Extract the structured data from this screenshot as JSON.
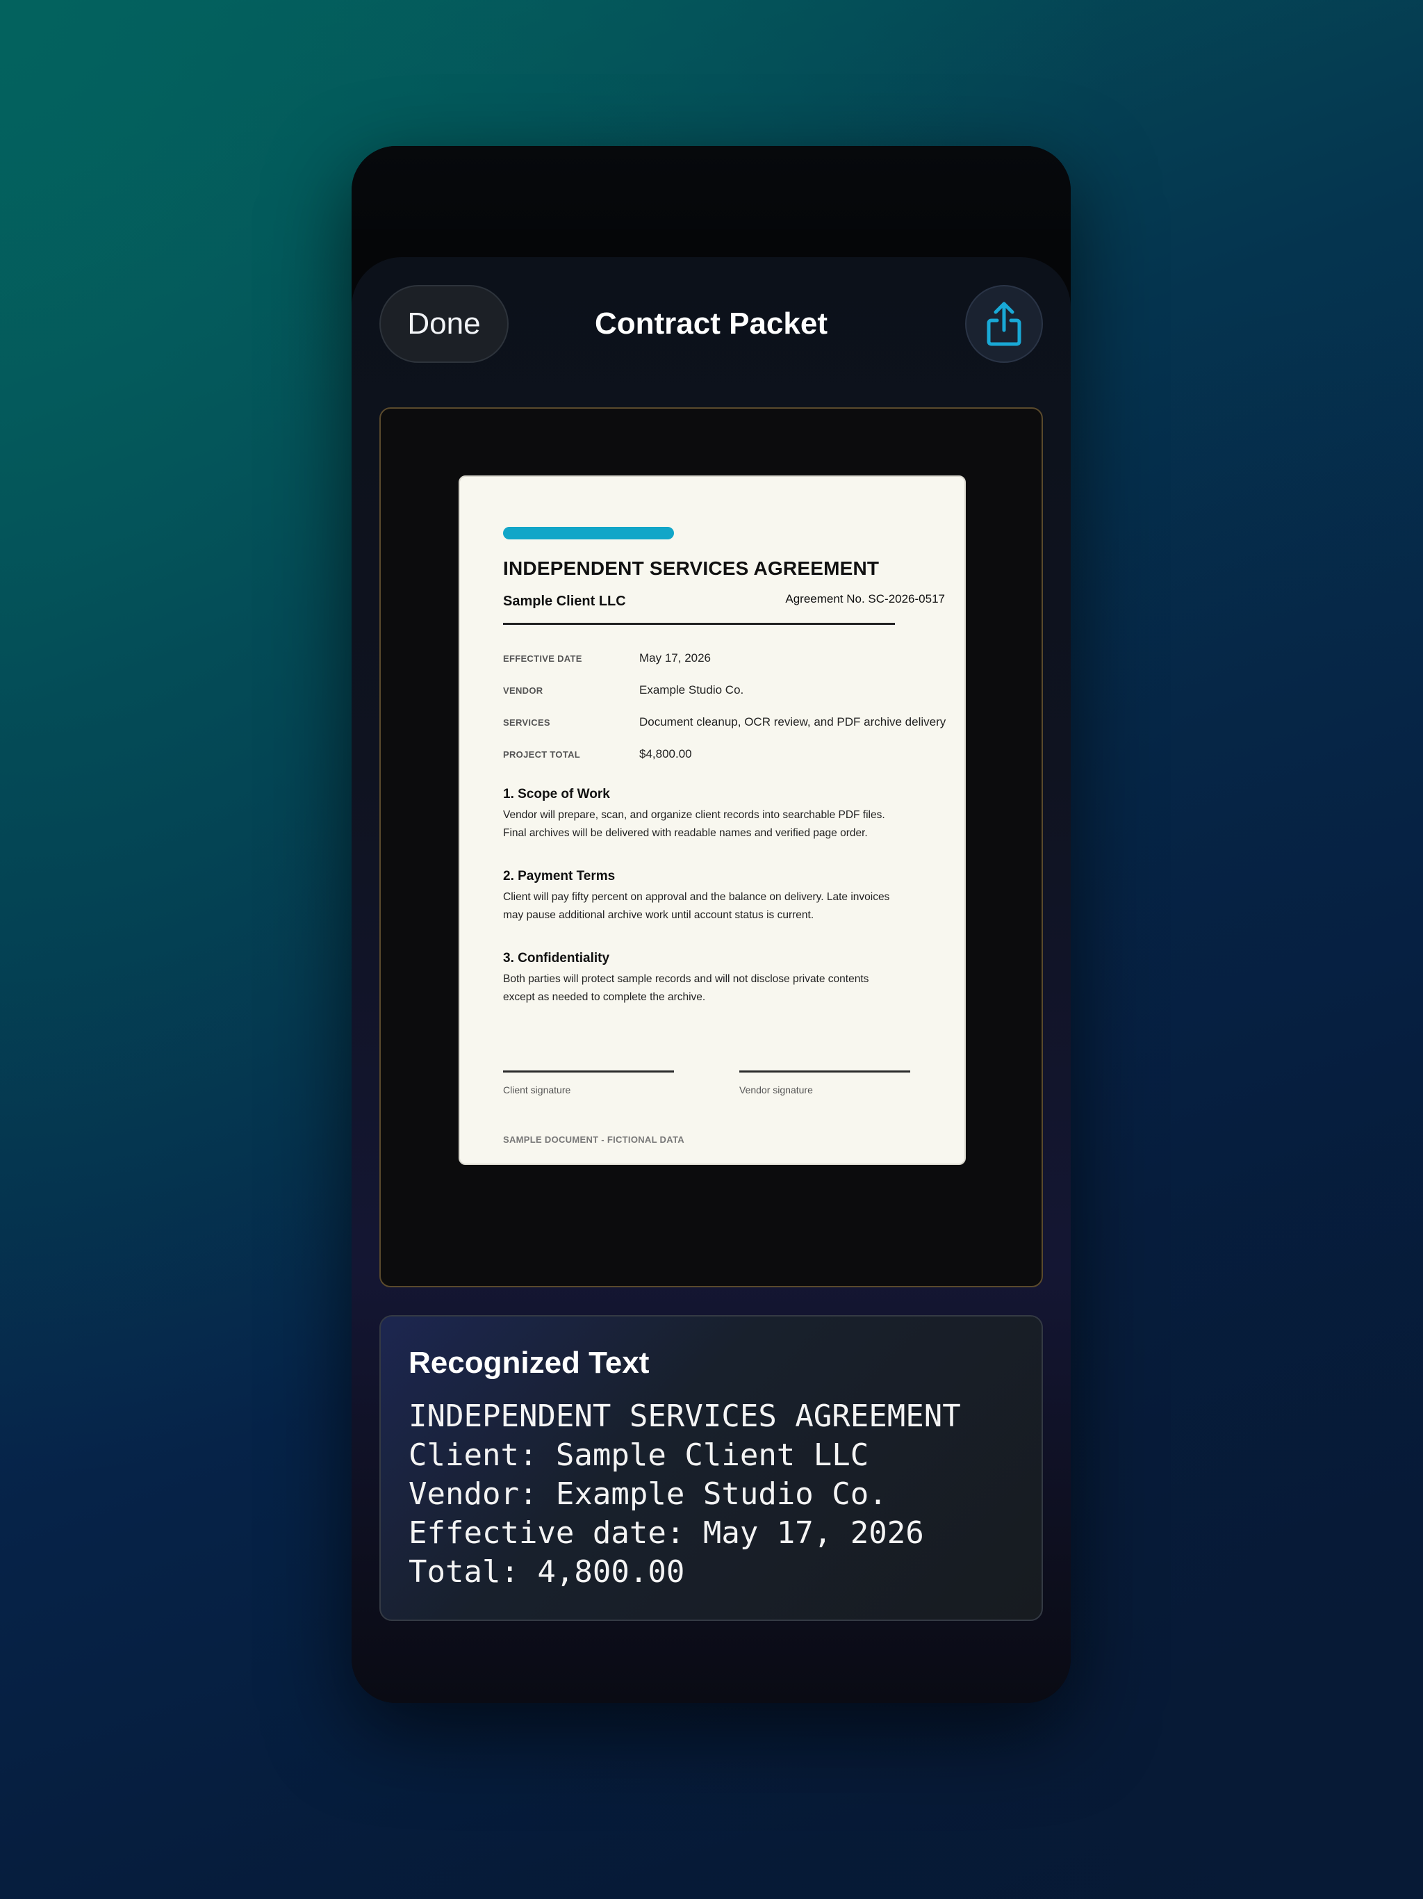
{
  "header": {
    "done_label": "Done",
    "title": "Contract Packet",
    "share_icon": "share-icon"
  },
  "document": {
    "accent_color": "#12a6c8",
    "title": "INDEPENDENT SERVICES AGREEMENT",
    "client": "Sample Client LLC",
    "agreement_no": "Agreement No. SC-2026-0517",
    "fields": [
      {
        "label": "EFFECTIVE DATE",
        "value": "May 17, 2026"
      },
      {
        "label": "VENDOR",
        "value": "Example Studio Co."
      },
      {
        "label": "SERVICES",
        "value": "Document cleanup, OCR review, and PDF archive delivery"
      },
      {
        "label": "PROJECT TOTAL",
        "value": "$4,800.00"
      }
    ],
    "sections": [
      {
        "heading": "1. Scope of Work",
        "body": "Vendor will prepare, scan, and organize client records into searchable PDF files. Final archives will be delivered with readable names and verified page order."
      },
      {
        "heading": "2. Payment Terms",
        "body": "Client will pay fifty percent on approval and the balance on delivery. Late invoices may pause additional archive work until account status is current."
      },
      {
        "heading": "3. Confidentiality",
        "body": "Both parties will protect sample records and will not disclose private contents except as needed to complete the archive."
      }
    ],
    "client_signature_label": "Client signature",
    "vendor_signature_label": "Vendor signature",
    "footer": "SAMPLE DOCUMENT - FICTIONAL DATA"
  },
  "ocr": {
    "heading": "Recognized Text",
    "lines": [
      "INDEPENDENT SERVICES AGREEMENT",
      "Client: Sample Client LLC",
      "Vendor: Example Studio Co.",
      "Effective date: May 17, 2026",
      "Total: 4,800.00"
    ]
  }
}
